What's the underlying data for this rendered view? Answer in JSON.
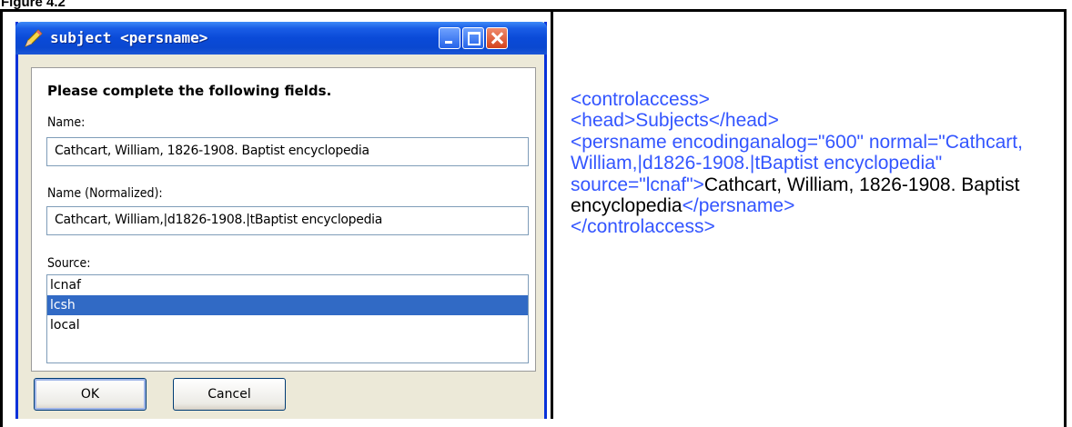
{
  "figure": {
    "label": "Figure 4.2"
  },
  "dialog": {
    "title": "subject <persname>",
    "instruction": "Please complete the following fields.",
    "name_label": "Name:",
    "name_value": "Cathcart, William, 1826-1908. Baptist encyclopedia",
    "normalized_label": "Name (Normalized):",
    "normalized_value": "Cathcart, William,|d1826-1908.|tBaptist encyclopedia",
    "source_label": "Source:",
    "source_options": [
      "lcnaf",
      "lcsh",
      "local"
    ],
    "source_selected": "lcsh",
    "ok_label": "OK",
    "cancel_label": "Cancel"
  },
  "xml": {
    "line1": "<controlaccess>",
    "line2": "<head>Subjects</head>",
    "tag_open": "<persname encodinganalog=\"600\" normal=\"Cathcart, William,|d1826-1908.|tBaptist encyclopedia\" source=\"lcnaf\">",
    "content": "Cathcart, William, 1826-1908. Baptist encyclopedia",
    "tag_close": "</persname>",
    "line_last": "</controlaccess>"
  },
  "colors": {
    "xml_markup": "#3355ff",
    "xml_content": "#000000",
    "selection": "#316ac5",
    "titlebar": "#0a4ad8"
  },
  "icons": {
    "title": "pencil-icon",
    "minimize": "minimize-icon",
    "maximize": "maximize-icon",
    "close": "close-icon"
  }
}
